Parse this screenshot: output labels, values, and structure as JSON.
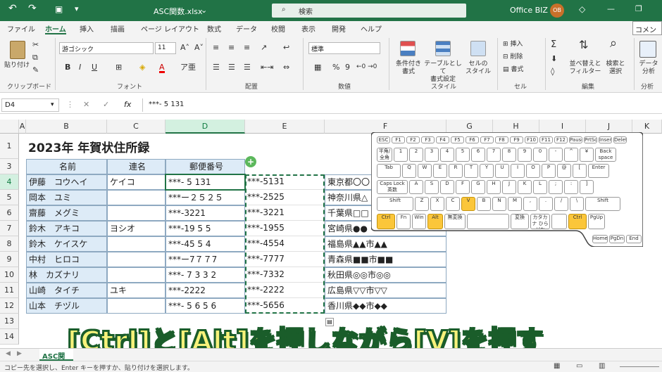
{
  "titlebar": {
    "filename": "ASC関数.xlsx",
    "search_placeholder": "検索",
    "account": "Office BIZ",
    "avatar": "OB",
    "colors": {
      "brand": "#217346"
    }
  },
  "tabs": [
    "ファイル",
    "ホーム",
    "挿入",
    "描画",
    "ページ レイアウト",
    "数式",
    "データ",
    "校閲",
    "表示",
    "開発",
    "ヘルプ"
  ],
  "active_tab": "ホーム",
  "comment_button": "コメン",
  "ribbon": {
    "paste": "貼り付け",
    "clipboard_group": "クリップボード",
    "font_name": "游ゴシック",
    "font_size": "11",
    "font_group": "フォント",
    "alignment_group": "配置",
    "number_format": "標準",
    "number_group": "数値",
    "conditional": [
      "条件付き",
      "書式"
    ],
    "as_table": [
      "テーブルとして",
      "書式設定"
    ],
    "cell_style": [
      "セルの",
      "スタイル"
    ],
    "style_group": "スタイル",
    "insert": "挿入",
    "delete": "削除",
    "format": "書式",
    "cells_group": "セル",
    "sort": [
      "並べ替えと",
      "フィルター"
    ],
    "find": [
      "検索と",
      "選択"
    ],
    "edit_group": "編集",
    "analyze": [
      "データ",
      "分析"
    ],
    "analysis_group": "分析"
  },
  "formula_bar": {
    "name_box": "D4",
    "fx": "fx",
    "value": "***- 5 131"
  },
  "columns": [
    "A",
    "B",
    "C",
    "D",
    "E",
    "F",
    "G",
    "H",
    "I",
    "J",
    "K"
  ],
  "rows": [
    "1",
    "3",
    "4",
    "5",
    "6",
    "7",
    "8",
    "9",
    "10",
    "11",
    "12",
    "13",
    "14"
  ],
  "sheet": {
    "title": "2023年 年賀状住所録",
    "headers": [
      "名前",
      "連名",
      "郵便番号"
    ],
    "data": [
      {
        "name": "伊藤　コウヘイ",
        "renmei": "ケイコ",
        "zip": "***- 5 131",
        "e": "***-5131",
        "f": "東京都〇〇"
      },
      {
        "name": "岡本　ユミ",
        "renmei": "",
        "zip": "***ー２５２５",
        "e": "***-2525",
        "f": "神奈川県△"
      },
      {
        "name": "齋藤　メグミ",
        "renmei": "",
        "zip": "***-3221",
        "e": "***-3221",
        "f": "千葉県□□"
      },
      {
        "name": "鈴木　アキコ",
        "renmei": "ヨシオ",
        "zip": "***-19 5 5",
        "e": "***-1955",
        "f": "宮崎県●●"
      },
      {
        "name": "鈴木　ケイスケ",
        "renmei": "",
        "zip": "***-45 5 4",
        "e": "***-4554",
        "f": "福島県▲▲市▲▲"
      },
      {
        "name": "中村　ヒロコ",
        "renmei": "",
        "zip": "***ー7７７7",
        "e": "***-7777",
        "f": "青森県■■市■■"
      },
      {
        "name": "林　カズナリ",
        "renmei": "",
        "zip": "***- 7 3 3 2",
        "e": "***-7332",
        "f": "秋田県◎◎市◎◎"
      },
      {
        "name": "山崎　タイチ",
        "renmei": "ユキ",
        "zip": "***-2222",
        "e": "***-2222",
        "f": "広島県▽▽市▽▽"
      },
      {
        "name": "山本　チヅル",
        "renmei": "",
        "zip": "***- 5 6 5 6",
        "e": "***-5656",
        "f": "香川県◆◆市◆◆"
      }
    ]
  },
  "keyboard": {
    "highlighted": [
      "Ctrl",
      "Alt",
      "V"
    ],
    "row1": [
      "ESC",
      "F1",
      "F2",
      "F3",
      "F4",
      "F5",
      "F6",
      "F7",
      "F8",
      "F9",
      "F10",
      "F11",
      "F12",
      "Pause",
      "PrtScr",
      "Insert",
      "Delete"
    ],
    "row2": [
      "半角/全角",
      "1",
      "2",
      "3",
      "4",
      "5",
      "6",
      "7",
      "8",
      "9",
      "0",
      "-",
      "^",
      "¥",
      "Back space"
    ],
    "row3": [
      "Tab",
      "Q",
      "W",
      "E",
      "R",
      "T",
      "Y",
      "U",
      "I",
      "O",
      "P",
      "@",
      "[",
      "Enter"
    ],
    "row4": [
      "Caps Lock 英数",
      "A",
      "S",
      "D",
      "F",
      "G",
      "H",
      "J",
      "K",
      "L",
      ";",
      ":",
      "]"
    ],
    "row5": [
      "Shift",
      "Z",
      "X",
      "C",
      "V",
      "B",
      "N",
      "M",
      ",",
      ".",
      "/",
      "\\",
      "Shift"
    ],
    "row6": [
      "Ctrl",
      "Fn",
      "Win",
      "Alt",
      "無変換",
      "",
      "変換",
      "カタカナ ひらがな",
      "",
      "Ctrl",
      "PgUp"
    ],
    "row7": [
      "Home",
      "PgDn",
      "End"
    ]
  },
  "overlay_caption": "[Ctrl]と[Alt]を押しながら[V]を押す",
  "sheet_tab": "ASC関",
  "status_text": "コピー先を選択し、Enter キーを押すか、貼り付けを選択します。"
}
